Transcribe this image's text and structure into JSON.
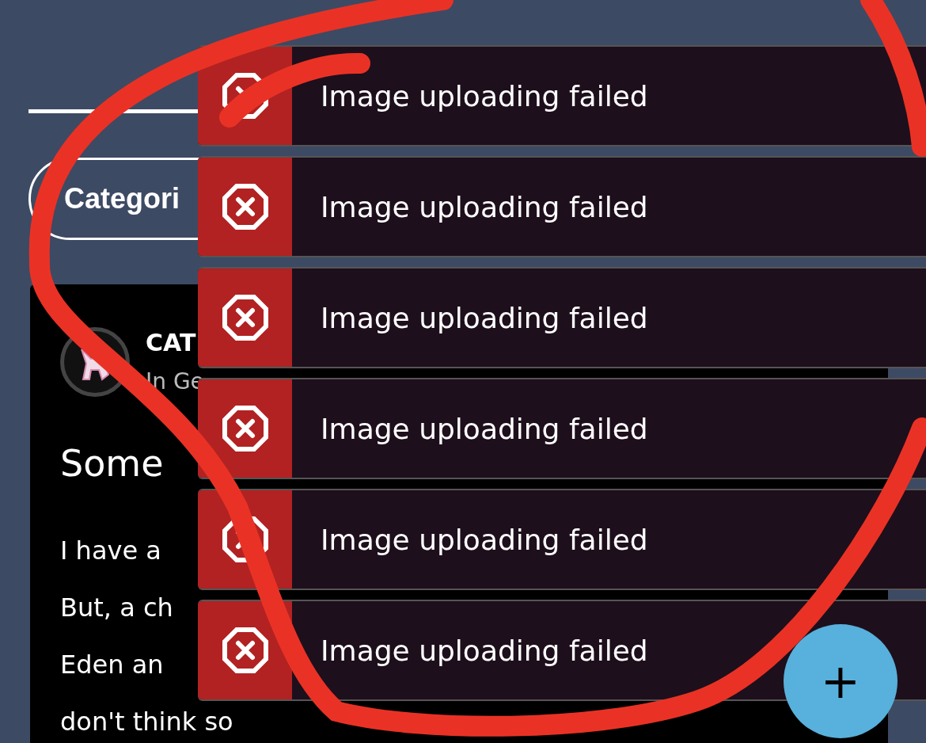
{
  "filter": {
    "label": "Categori"
  },
  "post": {
    "author": "CAT",
    "category": "In Ge",
    "title": "Some",
    "body_lines": [
      "I have a",
      "But, a ch",
      "Eden an",
      "don't think so"
    ]
  },
  "toasts": [
    {
      "message": "Image uploading failed"
    },
    {
      "message": "Image uploading failed"
    },
    {
      "message": "Image uploading failed"
    },
    {
      "message": "Image uploading failed"
    },
    {
      "message": "Image uploading failed"
    },
    {
      "message": "Image uploading failed"
    }
  ],
  "fab": {
    "label": "+"
  }
}
